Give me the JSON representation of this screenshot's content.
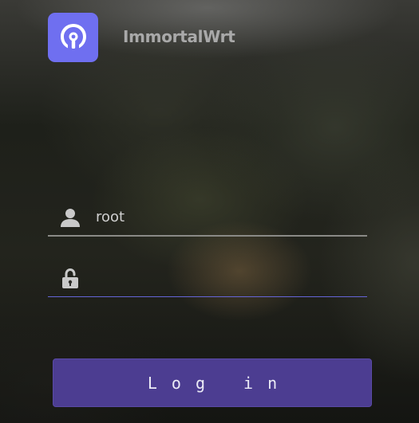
{
  "brand": {
    "name": "ImmortalWrt",
    "logo_icon": "openwrt-logo-icon",
    "logo_color": "#6f6ff0"
  },
  "login": {
    "username_icon": "user-icon",
    "username_value": "root",
    "password_icon": "unlock-icon",
    "password_value": "",
    "button_label": "Log in",
    "button_color": "#4c3d91",
    "focus_color": "#6565d8"
  }
}
